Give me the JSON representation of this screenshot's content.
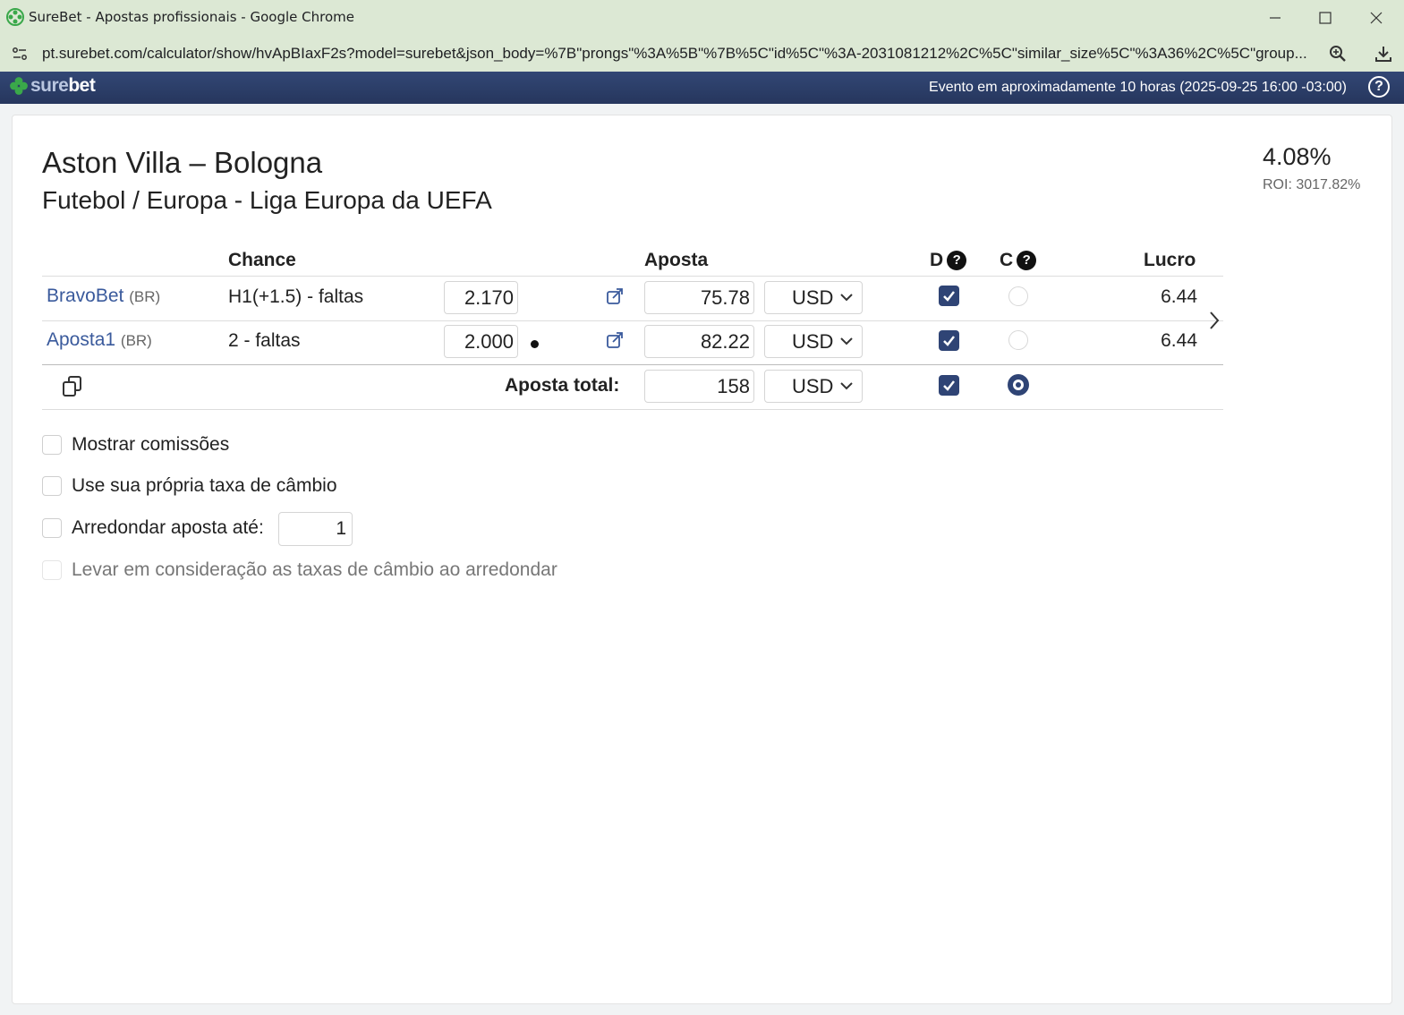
{
  "browser": {
    "window_title": "SureBet - Apostas profissionais - Google Chrome",
    "url": "pt.surebet.com/calculator/show/hvApBIaxF2s?model=surebet&json_body=%7B\"prongs\"%3A%5B\"%7B%5C\"id%5C\"%3A-2031081212%2C%5C\"similar_size%5C\"%3A36%2C%5C\"group..."
  },
  "header": {
    "logo_sure": "sure",
    "logo_bet": "bet",
    "event_text": "Evento em aproximadamente 10 horas (2025-09-25 16:00 -03:00)",
    "help": "?"
  },
  "match": {
    "title": "Aston Villa – Bologna",
    "subtitle": "Futebol / Europa - Liga Europa da UEFA",
    "percent": "4.08%",
    "roi": "ROI: 3017.82%"
  },
  "table": {
    "headers": {
      "chance": "Chance",
      "aposta": "Aposta",
      "d": "D",
      "c": "C",
      "lucro": "Lucro",
      "qmark": "?"
    },
    "rows": [
      {
        "bookmaker": "BravoBet",
        "country": "(BR)",
        "outcome": "H1(+1.5) - faltas",
        "odds": "2.170",
        "stake": "75.78",
        "currency": "USD",
        "d_checked": true,
        "c_checked": false,
        "profit": "6.44"
      },
      {
        "bookmaker": "Aposta1",
        "country": "(BR)",
        "outcome": "2 - faltas",
        "odds": "2.000",
        "stake": "82.22",
        "currency": "USD",
        "d_checked": true,
        "c_checked": false,
        "profit": "6.44"
      }
    ],
    "total": {
      "label": "Aposta total:",
      "stake": "158",
      "currency": "USD"
    }
  },
  "options": {
    "show_commissions": "Mostrar comissões",
    "own_exchange_rate": "Use sua própria taxa de câmbio",
    "round_bet": "Arredondar aposta até:",
    "round_value": "1",
    "consider_rates": "Levar em consideração as taxas de câmbio ao arredondar"
  },
  "colors": {
    "header_bg": "#2c3e6e",
    "accent": "#2f4475",
    "link": "#3a5a9c",
    "titlebar_bg": "#dce8d4"
  }
}
